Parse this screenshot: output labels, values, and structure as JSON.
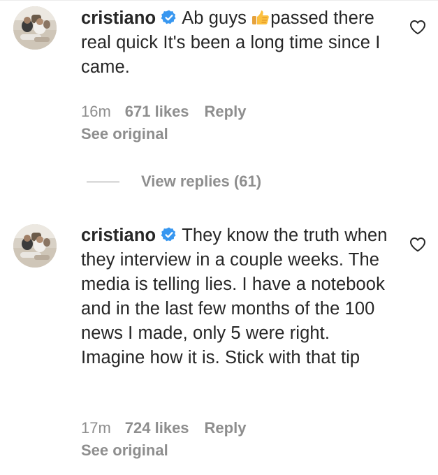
{
  "comments": [
    {
      "username": "cristiano",
      "emoji": "👍",
      "text_before_emoji": "Ab guys ",
      "text_after_emoji": "passed there real quick It's been a long time since I came.",
      "time": "16m",
      "likes": "671 likes",
      "reply_label": "Reply",
      "see_original_label": "See original"
    },
    {
      "username": "cristiano",
      "text": "They know the truth when they interview in a couple weeks. The media is telling lies. I have a notebook and in the last few months of the 100 news I made, only 5 were right. Imagine how it is. Stick with that tip",
      "time": "17m",
      "likes": "724 likes",
      "reply_label": "Reply",
      "see_original_label": "See original"
    }
  ],
  "view_replies_label": "View replies (61)",
  "icons": {
    "verified": "verified-badge-icon",
    "like": "heart-outline-icon",
    "emoji": "thumbs-up-icon"
  },
  "colors": {
    "text": "#262626",
    "secondary": "#8e8e8e",
    "verified": "#3897f0"
  }
}
